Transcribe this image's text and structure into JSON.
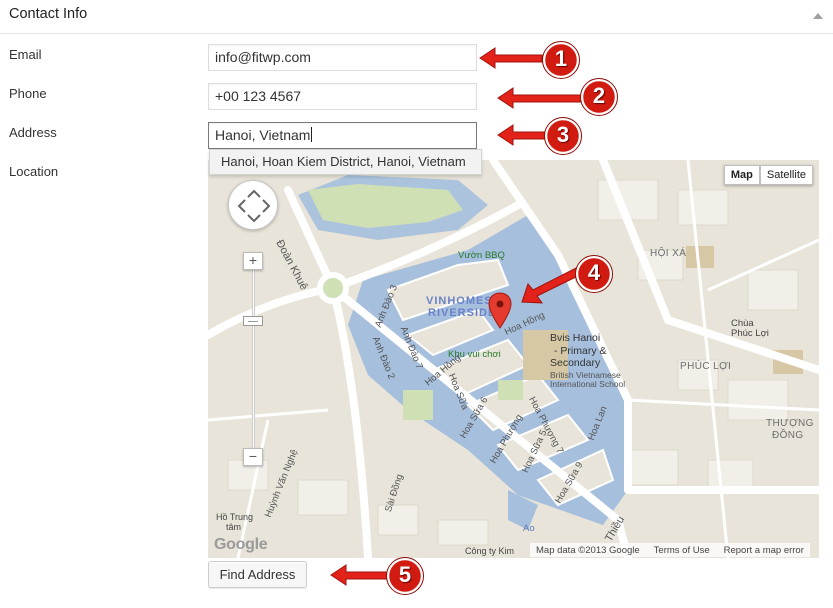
{
  "panel": {
    "title": "Contact Info"
  },
  "fields": {
    "email": {
      "label": "Email",
      "value": "info@fitwp.com"
    },
    "phone": {
      "label": "Phone",
      "value": "+00 123 4567"
    },
    "address": {
      "label": "Address",
      "value": "Hanoi, Vietnam",
      "suggestion": "Hanoi, Hoan Kiem District, Hanoi, Vietnam"
    },
    "location": {
      "label": "Location"
    }
  },
  "map": {
    "type_buttons": {
      "map": "Map",
      "satellite": "Satellite"
    },
    "zoom_in": "+",
    "zoom_out": "−",
    "google_logo": "Google",
    "footer": {
      "data": "Map data ©2013 Google",
      "terms": "Terms of Use",
      "report": "Report a map error"
    },
    "labels": {
      "hoi_xa": "HỘI XÁ",
      "chua_phuc_loi_1": "Chùa",
      "chua_phuc_loi_2": "Phúc Lợi",
      "phuc_loi": "PHÚC LỢI",
      "thuong_dong_1": "THƯỢNG",
      "thuong_dong_2": "ĐỒNG",
      "vinhomes_1": "VINHOMES",
      "vinhomes_2": "RIVERSIDE",
      "vuon_bbq": "Vườn BBQ",
      "khu_vui_choi": "Khu vui chơi",
      "bvis_1": "Bvis Hanoi",
      "bvis_2": "- Primary &",
      "bvis_3": "Secondary",
      "bris_1": "British Vietnamese",
      "bris_2": "International School",
      "doan_khue": "Đoàn Khuê",
      "anh_dao_3": "Anh Đào 3",
      "anh_dao_2": "Anh Đào 2",
      "anh_dao_7": "Anh Đào 7",
      "hoa_hong_1": "Hoa Hồng",
      "hoa_hong_2": "Hoa Hồng",
      "hoa_sua": "Hoa Sữa",
      "hoa_sua_6": "Hoa Sữa 6",
      "hoa_sua_5": "Hoa Sữa 5",
      "hoa_sua_9": "Hoa Sữa 9",
      "hoa_phuong_7": "Hoa Phượng 7",
      "hoa_phuong": "Hoa Phượng",
      "hoa_lan": "Hoa Lan",
      "huynh_van_nghe": "Huỳnh Văn Nghệ",
      "sai_dong": "Sài Đồng",
      "ho_trung_1": "Hồ Trung",
      "ho_trung_2": "tâm",
      "cong_ty_kim": "Công ty Kim",
      "thieu": "Thiều",
      "ao": "Ao"
    }
  },
  "buttons": {
    "find_address": "Find Address"
  },
  "annotations": [
    "1",
    "2",
    "3",
    "4",
    "5"
  ],
  "colors": {
    "arrow": "#e32219",
    "badge_fill": "#d11a10",
    "water": "#a5bfdd",
    "road": "#ffffff",
    "land": "#e8e4d9",
    "park": "#cfe0b5"
  }
}
